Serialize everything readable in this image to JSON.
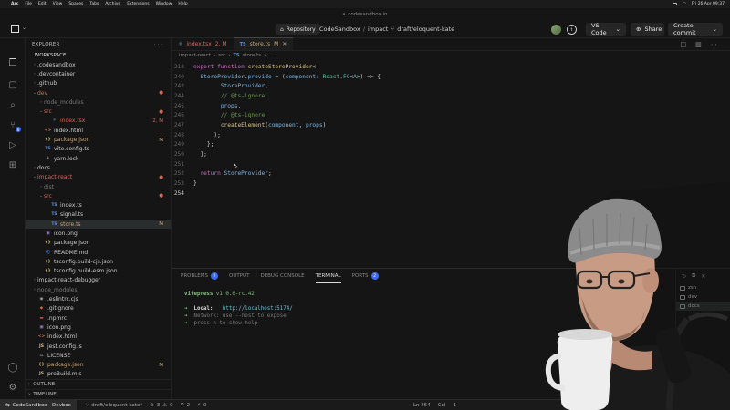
{
  "menubar": {
    "app": "Arc",
    "items": [
      "File",
      "Edit",
      "View",
      "Spaces",
      "Tabs",
      "Archive",
      "Extensions",
      "Window",
      "Help"
    ],
    "clock": "Fri 26 Apr 09:37"
  },
  "window": {
    "url": "codesandbox.io"
  },
  "toolbar": {
    "repository_label": "Repository",
    "crumb_org": "CodeSandbox",
    "crumb_repo": "impact",
    "crumb_branch": "draft/eloquent-kate",
    "vscode_label": "VS Code",
    "share_label": "Share",
    "commit_label": "Create commit"
  },
  "explorer": {
    "title": "EXPLORER",
    "section": "WORKSPACE",
    "outline": "OUTLINE",
    "timeline": "TIMELINE",
    "items": [
      {
        "label": ".codesandbox",
        "chev": "›",
        "icon": "",
        "status": "",
        "indent": 1
      },
      {
        "label": ".devcontainer",
        "chev": "›",
        "icon": "",
        "status": "",
        "indent": 1
      },
      {
        "label": ".github",
        "chev": "›",
        "icon": "",
        "status": "",
        "indent": 1
      },
      {
        "label": "dev",
        "chev": "⌄",
        "icon": "",
        "status": "●",
        "indent": 1,
        "cls": "c-red"
      },
      {
        "label": "node_modules",
        "chev": "›",
        "icon": "",
        "status": "",
        "indent": 2,
        "cls": "c-dim"
      },
      {
        "label": "src",
        "chev": "⌄",
        "icon": "",
        "status": "●",
        "indent": 2,
        "cls": "c-red"
      },
      {
        "label": "index.tsx",
        "chev": "",
        "icon": "⚛",
        "status": "2, M",
        "indent": 3,
        "cls": "c-red"
      },
      {
        "label": "index.html",
        "chev": "",
        "icon": "<>",
        "status": "",
        "indent": 2
      },
      {
        "label": "package.json",
        "chev": "",
        "icon": "{}",
        "status": "M",
        "indent": 2,
        "cls": "c-mod"
      },
      {
        "label": "vite.config.ts",
        "chev": "",
        "icon": "TS",
        "status": "",
        "indent": 2
      },
      {
        "label": "yarn.lock",
        "chev": "",
        "icon": "⚘",
        "status": "",
        "indent": 2
      },
      {
        "label": "docs",
        "chev": "›",
        "icon": "",
        "status": "",
        "indent": 1
      },
      {
        "label": "impact-react",
        "chev": "⌄",
        "icon": "",
        "status": "●",
        "indent": 1,
        "cls": "c-red"
      },
      {
        "label": "dist",
        "chev": "›",
        "icon": "",
        "status": "",
        "indent": 2,
        "cls": "c-dim"
      },
      {
        "label": "src",
        "chev": "⌄",
        "icon": "",
        "status": "●",
        "indent": 2,
        "cls": "c-red"
      },
      {
        "label": "index.ts",
        "chev": "",
        "icon": "TS",
        "status": "",
        "indent": 3
      },
      {
        "label": "signal.ts",
        "chev": "",
        "icon": "TS",
        "status": "",
        "indent": 3
      },
      {
        "label": "store.ts",
        "chev": "",
        "icon": "TS",
        "status": "M",
        "indent": 3,
        "cls": "c-mod",
        "sel": true
      },
      {
        "label": "icon.png",
        "chev": "",
        "icon": "▣",
        "status": "",
        "indent": 2
      },
      {
        "label": "package.json",
        "chev": "",
        "icon": "{}",
        "status": "",
        "indent": 2
      },
      {
        "label": "README.md",
        "chev": "",
        "icon": "ⓘ",
        "status": "",
        "indent": 2
      },
      {
        "label": "tsconfig.build-cjs.json",
        "chev": "",
        "icon": "{}",
        "status": "",
        "indent": 2
      },
      {
        "label": "tsconfig.build-esm.json",
        "chev": "",
        "icon": "{}",
        "status": "",
        "indent": 2
      },
      {
        "label": "impact-react-debugger",
        "chev": "›",
        "icon": "",
        "status": "",
        "indent": 1
      },
      {
        "label": "node_modules",
        "chev": "›",
        "icon": "",
        "status": "",
        "indent": 1,
        "cls": "c-dim"
      },
      {
        "label": ".eslintrc.cjs",
        "chev": "",
        "icon": "◉",
        "status": "",
        "indent": 1
      },
      {
        "label": ".gitignore",
        "chev": "",
        "icon": "◆",
        "status": "",
        "indent": 1
      },
      {
        "label": ".npmrc",
        "chev": "",
        "icon": "▬",
        "status": "",
        "indent": 1
      },
      {
        "label": "icon.png",
        "chev": "",
        "icon": "▣",
        "status": "",
        "indent": 1
      },
      {
        "label": "index.html",
        "chev": "",
        "icon": "<>",
        "status": "",
        "indent": 1
      },
      {
        "label": "jest.config.js",
        "chev": "",
        "icon": "JS",
        "status": "",
        "indent": 1
      },
      {
        "label": "LICENSE",
        "chev": "",
        "icon": "⚖",
        "status": "",
        "indent": 1
      },
      {
        "label": "package.json",
        "chev": "",
        "icon": "{}",
        "status": "M",
        "indent": 1,
        "cls": "c-mod"
      },
      {
        "label": "preBuild.mjs",
        "chev": "",
        "icon": "JS",
        "status": "",
        "indent": 1
      }
    ]
  },
  "editor": {
    "tabs": [
      {
        "label": "index.tsx",
        "status": "2, M",
        "active": false
      },
      {
        "label": "store.ts",
        "status": "M",
        "active": true
      }
    ],
    "crumbs": [
      "impact-react",
      "src",
      "TS",
      "store.ts",
      "..."
    ],
    "lines": [
      {
        "n": "213",
        "html": "<span class='k'>export function</span> <span class='f'>createStoreProvider</span><span class='p'>&lt;</span>"
      },
      {
        "n": "240",
        "html": "  <span class='v'>StoreProvider</span><span class='p'>.</span><span class='v'>provide</span> <span class='p'>= (</span><span class='v'>component</span><span class='p'>: </span><span class='t'>React</span><span class='p'>.</span><span class='t'>FC</span><span class='p'>&lt;</span><span class='t'>A</span><span class='p'>&gt;) =&gt; {</span>"
      },
      {
        "n": "243",
        "html": "        <span class='v'>StoreProvider</span><span class='p'>,</span>"
      },
      {
        "n": "244",
        "html": "        <span class='cm'>// @ts-ignore</span>"
      },
      {
        "n": "245",
        "html": "        <span class='v'>props</span><span class='p'>,</span>"
      },
      {
        "n": "246",
        "html": "        <span class='cm'>// @ts-ignore</span>"
      },
      {
        "n": "247",
        "html": "        <span class='f'>createElement</span><span class='p'>(</span><span class='v'>component</span><span class='p'>, </span><span class='v'>props</span><span class='p'>)</span>"
      },
      {
        "n": "248",
        "html": "      <span class='p'>);</span>"
      },
      {
        "n": "249",
        "html": "    <span class='p'>};</span>"
      },
      {
        "n": "250",
        "html": "  <span class='p'>};</span>"
      },
      {
        "n": "251",
        "html": ""
      },
      {
        "n": "252",
        "html": "  <span class='k'>return</span> <span class='v'>StoreProvider</span><span class='p'>;</span>"
      },
      {
        "n": "253",
        "html": "<span class='p'>}</span>"
      },
      {
        "n": "254",
        "html": ""
      }
    ]
  },
  "panel": {
    "tabs": [
      {
        "label": "PROBLEMS",
        "badge": "2"
      },
      {
        "label": "OUTPUT",
        "badge": ""
      },
      {
        "label": "DEBUG CONSOLE",
        "badge": ""
      },
      {
        "label": "TERMINAL",
        "badge": "",
        "active": true
      },
      {
        "label": "PORTS",
        "badge": "2"
      }
    ],
    "terminal": {
      "title": "vitepress",
      "version": "v1.0.0-rc.42",
      "local_label": "Local:",
      "local_url": "http://localhost:5174/",
      "network": "Network: use --host to expose",
      "help": "press h to show help"
    },
    "sessions": [
      "zsh",
      "dev",
      "docs"
    ]
  },
  "statusbar": {
    "remote": "CodeSandbox - Devbox",
    "branch": "draft/eloquent-kate*",
    "errors": "3",
    "warnings": "0",
    "ports": "2",
    "tests": "0",
    "position": "Ln 254",
    "col": "Col",
    "colnum": "1"
  }
}
